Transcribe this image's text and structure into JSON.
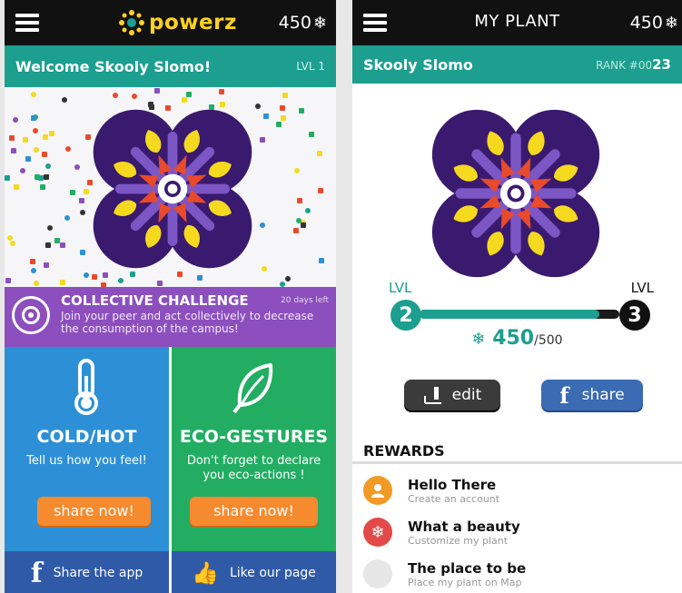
{
  "left": {
    "brand": "powerz",
    "points": "450",
    "welcome": "Welcome Skooly Slomo!",
    "level": "LVL 1",
    "challenge": {
      "title": "COLLECTIVE CHALLENGE",
      "days_left": "20 days left",
      "description": "Join your peer and act collectively to decrease the consumption of the campus!"
    },
    "cards": [
      {
        "title": "COLD/HOT",
        "subtitle": "Tell us how you feel!",
        "button": "share now!",
        "icon": "thermometer-icon",
        "color": "#2d90d6"
      },
      {
        "title": "ECO-GESTURES",
        "subtitle": "Don't forget to declare you eco-actions !",
        "button": "share now!",
        "icon": "leaf-icon",
        "color": "#22ad62"
      }
    ],
    "bottom": [
      {
        "label": "Share the app",
        "icon": "facebook-icon"
      },
      {
        "label": "Like our page",
        "icon": "thumbs-up-icon"
      }
    ]
  },
  "right": {
    "title": "MY PLANT",
    "points": "450",
    "user": "Skooly Slomo",
    "rank_prefix": "RANK #00",
    "rank_num": "23",
    "level_current_label": "LVL",
    "level_current": "2",
    "level_next_label": "LVL",
    "level_next": "3",
    "progress_value": 450,
    "progress_max": 500,
    "score": "450",
    "score_max": "/500",
    "edit_label": "edit",
    "share_label": "share",
    "rewards_title": "REWARDS",
    "rewards": [
      {
        "title": "Hello There",
        "desc": "Create an account",
        "color": "#f29a26",
        "icon": "user-icon"
      },
      {
        "title": "What a beauty",
        "desc": "Customize my plant",
        "color": "#e24a4a",
        "icon": "snowflake-icon"
      },
      {
        "title": "The place to be",
        "desc": "Place my plant on Map",
        "color": "#e6e6e6",
        "icon": "map-icon"
      }
    ]
  },
  "colors": {
    "teal": "#1c9f8f",
    "purple": "#8c4fbd",
    "orange": "#f58a2e",
    "plant_petal": "#3a1a6e",
    "plant_inner": "#e84a2b",
    "plant_leaf": "#f5d91f"
  }
}
